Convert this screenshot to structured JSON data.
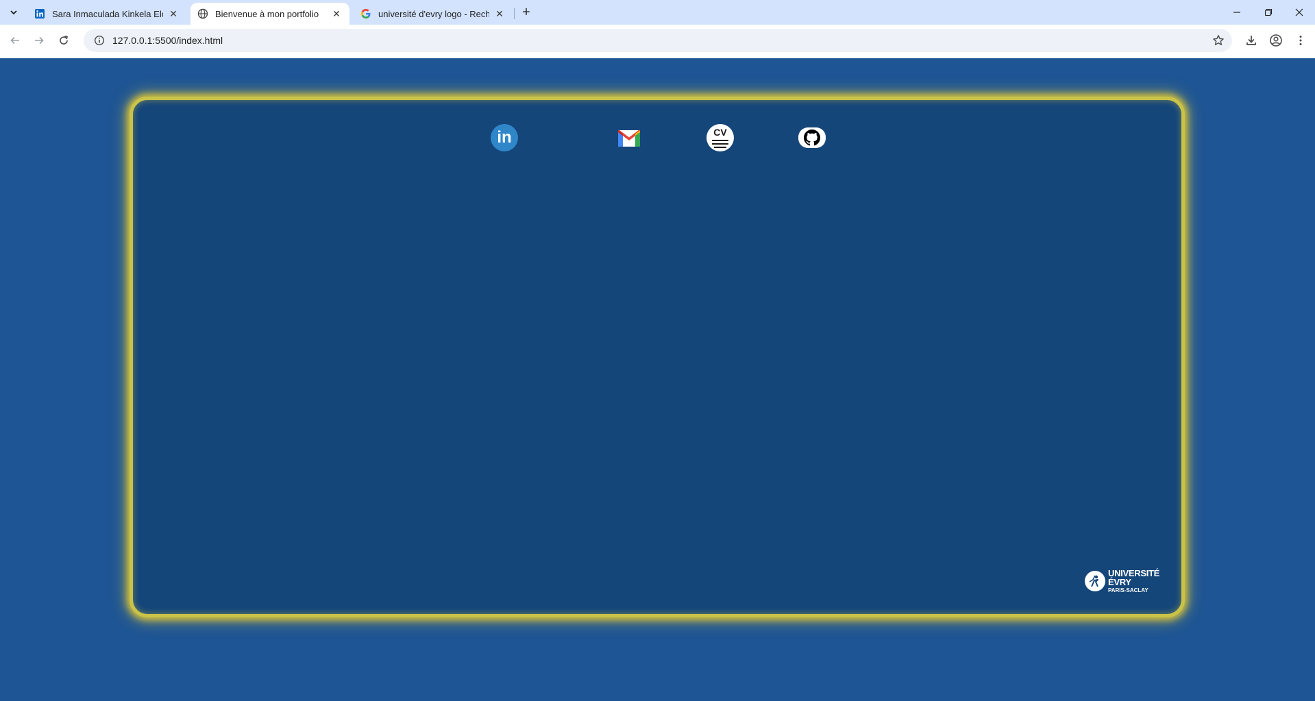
{
  "browser": {
    "tabs": [
      {
        "title": "Sara Inmaculada Kinkela Elonga",
        "favicon": "linkedin-icon",
        "active": false
      },
      {
        "title": "Bienvenue à mon portfolio",
        "favicon": "globe-icon",
        "active": true
      },
      {
        "title": "université d'evry logo - Recherche",
        "favicon": "google-icon",
        "active": false
      }
    ],
    "url": "127.0.0.1:5500/index.html"
  },
  "portfolio": {
    "social_links": [
      {
        "name": "linkedin",
        "icon": "linkedin-icon",
        "text": "in"
      },
      {
        "name": "gmail",
        "icon": "gmail-icon"
      },
      {
        "name": "cv",
        "icon": "cv-icon",
        "text": "CV"
      },
      {
        "name": "github",
        "icon": "github-icon"
      }
    ],
    "logo": {
      "line1": "UNIVERSITÉ ÉVRY",
      "line2": "PARIS-SACLAY"
    }
  },
  "colors": {
    "page_background": "#1e5594",
    "card_background": "#15467a",
    "card_glow": "#d8c238",
    "tabstrip": "#d3e3fd"
  }
}
